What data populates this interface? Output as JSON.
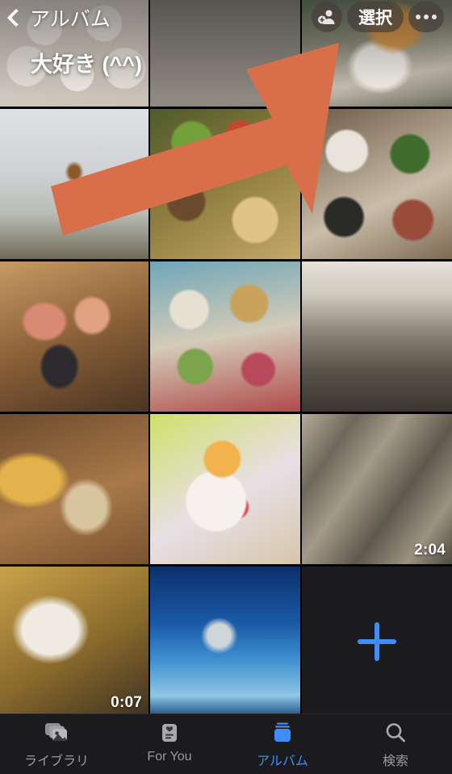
{
  "header": {
    "back_label": "アルバム",
    "back_icon": "chevron-left-icon",
    "album_title": "大好き (^^)",
    "add_people_icon": "person-add-icon",
    "select_label": "選択",
    "more_icon": "ellipsis-icon"
  },
  "grid": {
    "items": [
      {
        "name": "maneki-neko-cats",
        "texture": "p-cats",
        "duration": ""
      },
      {
        "name": "pancakes-plate",
        "texture": "p-pancake",
        "duration": ""
      },
      {
        "name": "karaage-cup",
        "texture": "p-karaage",
        "duration": ""
      },
      {
        "name": "sakura-skewer",
        "texture": "p-sakura",
        "duration": ""
      },
      {
        "name": "bento-box-green",
        "texture": "p-bento1",
        "duration": ""
      },
      {
        "name": "bento-containers",
        "texture": "p-bento2",
        "duration": ""
      },
      {
        "name": "sashimi-platter",
        "texture": "p-sashimi",
        "duration": ""
      },
      {
        "name": "picnic-spread",
        "texture": "p-picnic",
        "duration": ""
      },
      {
        "name": "shop-interior",
        "texture": "p-shop",
        "duration": ""
      },
      {
        "name": "beer-and-sushi",
        "texture": "p-beer",
        "duration": ""
      },
      {
        "name": "dessert-plate",
        "texture": "p-cake",
        "duration": ""
      },
      {
        "name": "wooden-boards",
        "texture": "p-wood",
        "duration": "2:04"
      },
      {
        "name": "toilet-bowl-shoes",
        "texture": "p-toilet",
        "duration": "0:07"
      },
      {
        "name": "dolphin-jump",
        "texture": "p-dolphin",
        "duration": ""
      }
    ],
    "add_button_icon": "plus-icon"
  },
  "annotation": {
    "arrow_color": "#d96e4b",
    "points_to": "選択"
  },
  "tabbar": {
    "tabs": [
      {
        "label": "ライブラリ",
        "icon": "photos-stack-icon",
        "active": false
      },
      {
        "label": "For You",
        "icon": "heart-card-icon",
        "active": false
      },
      {
        "label": "アルバム",
        "icon": "albums-icon",
        "active": true
      },
      {
        "label": "検索",
        "icon": "search-icon",
        "active": false
      }
    ],
    "active_color": "#3f8dfd",
    "inactive_color": "#9a9a9e"
  }
}
